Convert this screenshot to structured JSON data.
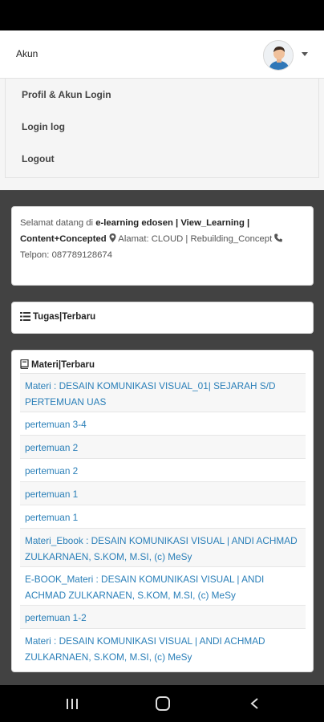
{
  "account": {
    "title": "Akun",
    "menu": [
      "Profil & Akun Login",
      "Login log",
      "Logout"
    ]
  },
  "welcome": {
    "prefix": "Selamat datang di ",
    "site": "e-learning edosen | View_Learning | Content+Concepted",
    "address_label": "Alamat: CLOUD | Rebuilding_Concept",
    "phone_label": "Telpon:",
    "phone": "087789128674"
  },
  "tasks": {
    "title": "Tugas|Terbaru"
  },
  "materials": {
    "title": "Materi|Terbaru",
    "items": [
      "Materi : DESAIN KOMUNIKASI VISUAL_01| SEJARAH S/D PERTEMUAN UAS",
      "pertemuan 3-4",
      "pertemuan 2",
      "pertemuan 2",
      "pertemuan 1",
      "pertemuan 1",
      "Materi_Ebook : DESAIN KOMUNIKASI VISUAL | ANDI ACHMAD ZULKARNAEN, S.KOM, M.SI, (c) MeSy",
      "E-BOOK_Materi : DESAIN KOMUNIKASI VISUAL | ANDI ACHMAD ZULKARNAEN, S.KOM, M.SI, (c) MeSy",
      "pertemuan 1-2",
      "Materi : DESAIN KOMUNIKASI VISUAL | ANDI ACHMAD ZULKARNAEN, S.KOM, M.SI, (c) MeSy"
    ]
  },
  "icons": {
    "avatar": "user-avatar",
    "dropdown": "caret-down-icon",
    "address": "map-marker-icon",
    "phone": "phone-icon",
    "tasks": "list-icon",
    "materials": "book-icon",
    "nav": [
      "recent-apps-icon",
      "home-icon",
      "back-icon"
    ]
  },
  "colors": {
    "link": "#2a7fb8",
    "background": "#424242"
  }
}
